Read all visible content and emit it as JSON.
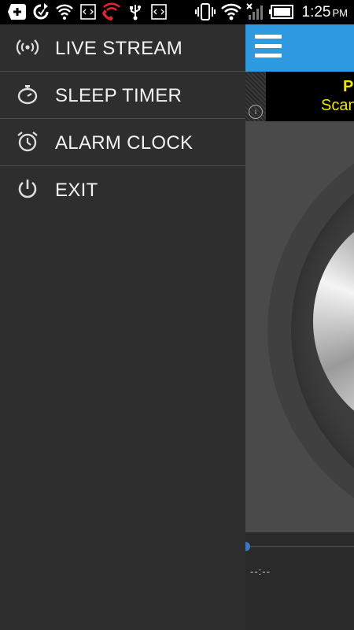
{
  "status_bar": {
    "time": "1:25",
    "ampm": "PM",
    "icons": [
      "add-icon",
      "sync-icon",
      "wifi-icon",
      "code-icon",
      "phone-wifi-icon",
      "usb-icon",
      "code-icon",
      "vibrate-icon",
      "wifi-signal-icon",
      "cell-signal-icon",
      "battery-icon"
    ]
  },
  "drawer": {
    "items": [
      {
        "label": "LIVE STREAM",
        "icon": "radio-waves-icon"
      },
      {
        "label": "SLEEP TIMER",
        "icon": "stopwatch-icon"
      },
      {
        "label": "ALARM CLOCK",
        "icon": "alarm-clock-icon"
      },
      {
        "label": "EXIT",
        "icon": "power-icon"
      }
    ]
  },
  "app": {
    "ad": {
      "line1": "P",
      "line2": "Scan",
      "info": "i"
    },
    "player": {
      "time": "--:--"
    },
    "accent": "#2f9ae0"
  }
}
